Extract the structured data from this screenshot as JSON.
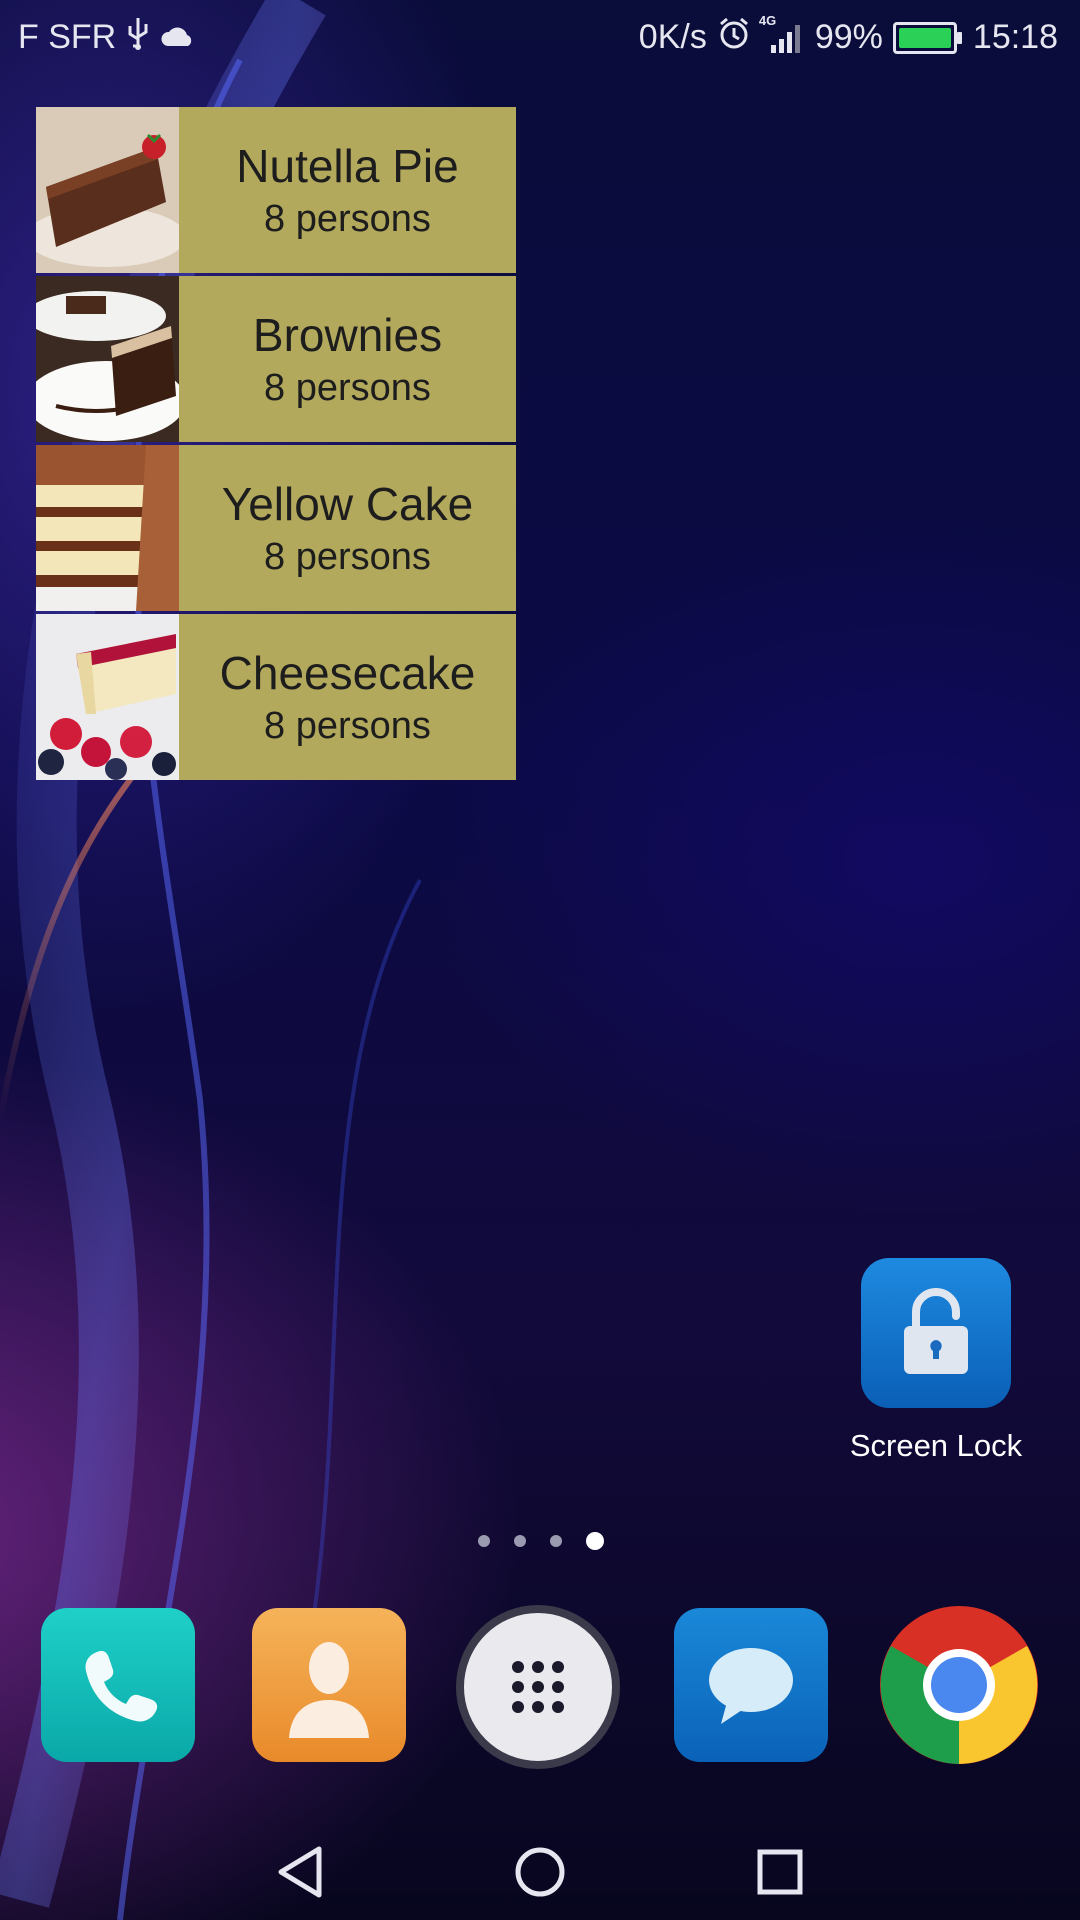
{
  "status_bar": {
    "carrier": "F SFR",
    "net_speed": "0K/s",
    "network_type": "4G",
    "battery_level": "99%",
    "time": "15:18",
    "battery_color": "#2bd157"
  },
  "recipes_widget": {
    "card_color": "#b2a95c",
    "items": [
      {
        "name": "Nutella Pie",
        "servings": "8 persons",
        "image_icon": "chocolate-cake-slice"
      },
      {
        "name": "Brownies",
        "servings": "8 persons",
        "image_icon": "brownie-plate"
      },
      {
        "name": "Yellow Cake",
        "servings": "8 persons",
        "image_icon": "layer-cake"
      },
      {
        "name": "Cheesecake",
        "servings": "8 persons",
        "image_icon": "cheesecake-berries"
      }
    ]
  },
  "home_apps": {
    "screen_lock_label": "Screen Lock"
  },
  "page_indicator": {
    "count": 4,
    "active_index": 3
  },
  "dock": {
    "items": [
      "phone-icon",
      "contacts-icon",
      "app-drawer-icon",
      "messages-icon",
      "chrome-icon"
    ]
  },
  "nav_bar": {
    "items": [
      "back-icon",
      "home-icon",
      "recents-icon"
    ]
  }
}
